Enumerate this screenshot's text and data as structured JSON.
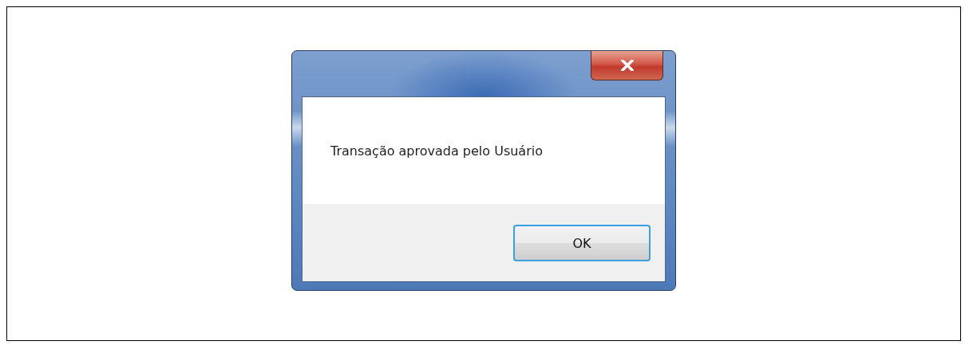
{
  "dialog": {
    "message": "Transação aprovada pelo Usuário",
    "buttons": [
      {
        "label": "OK",
        "default": true
      }
    ]
  }
}
